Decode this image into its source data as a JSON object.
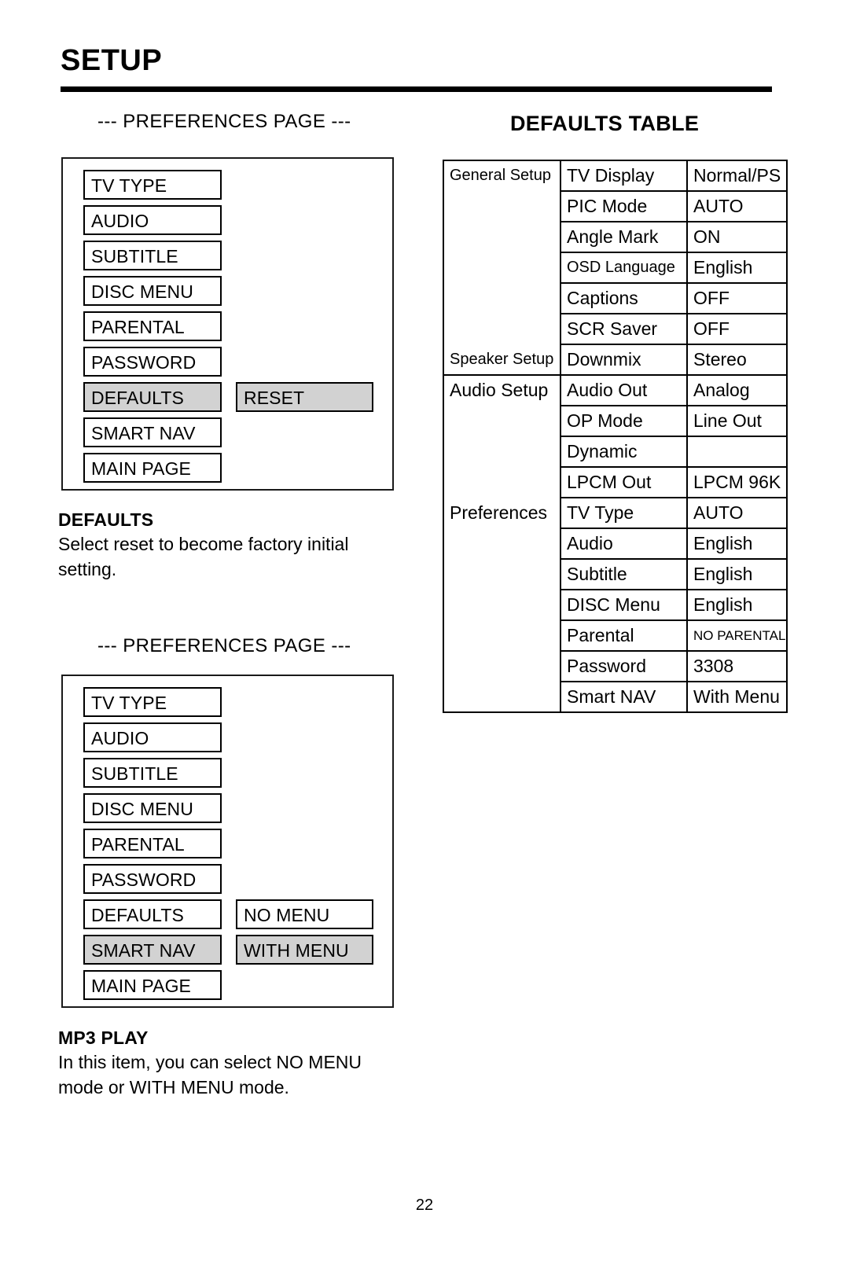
{
  "header": {
    "title": "SETUP"
  },
  "left_column": {
    "panel1": {
      "caption": "--- PREFERENCES PAGE ---",
      "left_items": [
        {
          "label": "TV TYPE",
          "selected": false
        },
        {
          "label": "AUDIO",
          "selected": false
        },
        {
          "label": "SUBTITLE",
          "selected": false
        },
        {
          "label": "DISC MENU",
          "selected": false
        },
        {
          "label": "PARENTAL",
          "selected": false
        },
        {
          "label": "PASSWORD",
          "selected": false
        },
        {
          "label": "DEFAULTS",
          "selected": true
        },
        {
          "label": "SMART NAV",
          "selected": false
        },
        {
          "label": "MAIN PAGE",
          "selected": false
        }
      ],
      "right_items": [
        {
          "label": "RESET",
          "selected": true,
          "row": 6
        }
      ]
    },
    "section1": {
      "heading": "DEFAULTS",
      "body": "Select reset to become factory initial setting."
    },
    "panel2": {
      "caption": "--- PREFERENCES PAGE ---",
      "left_items": [
        {
          "label": "TV TYPE",
          "selected": false
        },
        {
          "label": "AUDIO",
          "selected": false
        },
        {
          "label": "SUBTITLE",
          "selected": false
        },
        {
          "label": "DISC MENU",
          "selected": false
        },
        {
          "label": "PARENTAL",
          "selected": false
        },
        {
          "label": "PASSWORD",
          "selected": false
        },
        {
          "label": "DEFAULTS",
          "selected": false
        },
        {
          "label": "SMART NAV",
          "selected": true
        },
        {
          "label": "MAIN PAGE",
          "selected": false
        }
      ],
      "right_items": [
        {
          "label": "NO MENU",
          "selected": false,
          "row": 6
        },
        {
          "label": "WITH MENU",
          "selected": true,
          "row": 7
        }
      ]
    },
    "section2": {
      "heading": "MP3 PLAY",
      "body": "In this item, you can select NO MENU mode or WITH MENU mode."
    }
  },
  "right_column": {
    "table_title": "DEFAULTS TABLE",
    "table_rows": [
      {
        "group": "General Setup",
        "item": "TV Display",
        "value": "Normal/PS"
      },
      {
        "group": "",
        "item": "PIC Mode",
        "value": "AUTO"
      },
      {
        "group": "",
        "item": "Angle Mark",
        "value": "ON"
      },
      {
        "group": "",
        "item": "OSD Language",
        "value": "English"
      },
      {
        "group": "",
        "item": "Captions",
        "value": "OFF"
      },
      {
        "group": "",
        "item": "SCR Saver",
        "value": "OFF"
      },
      {
        "group": "Speaker Setup",
        "item": "Downmix",
        "value": "Stereo"
      },
      {
        "group": "Audio Setup",
        "item": "Audio Out",
        "value": "Analog"
      },
      {
        "group": "",
        "item": "OP Mode",
        "value": "Line Out"
      },
      {
        "group": "",
        "item": "Dynamic",
        "value": ""
      },
      {
        "group": "",
        "item": "LPCM Out",
        "value": "LPCM 96K"
      },
      {
        "group": "Preferences",
        "item": "TV Type",
        "value": "AUTO"
      },
      {
        "group": "",
        "item": "Audio",
        "value": "English"
      },
      {
        "group": "",
        "item": "Subtitle",
        "value": "English"
      },
      {
        "group": "",
        "item": "DISC Menu",
        "value": "English"
      },
      {
        "group": "",
        "item": "Parental",
        "value": "NO PARENTAL"
      },
      {
        "group": "",
        "item": "Password",
        "value": "3308"
      },
      {
        "group": "",
        "item": "Smart NAV",
        "value": "With Menu"
      }
    ]
  },
  "footer": {
    "page_number": "22"
  },
  "colors": {
    "selected_background": "#d2d2d2",
    "border": "#000000",
    "text": "#000000",
    "page_background": "#ffffff"
  }
}
